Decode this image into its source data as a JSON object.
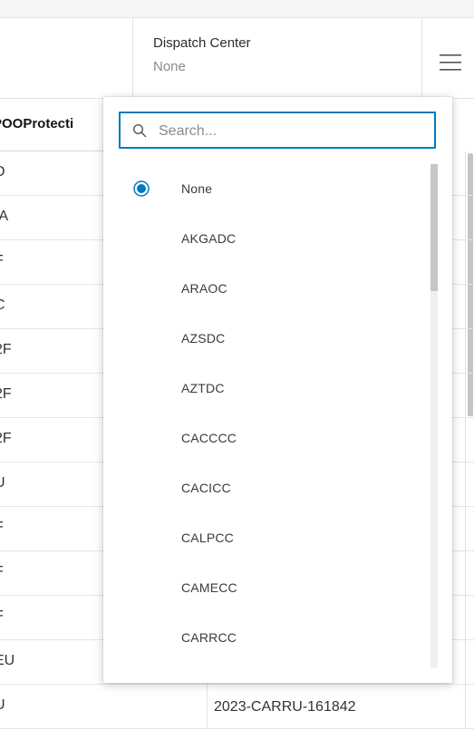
{
  "toolbar": {
    "filter_label": "Dispatch Center",
    "filter_value": "None",
    "menu_icon": "hamburger-menu-icon"
  },
  "table": {
    "column_header": "POOProtecti",
    "rows": [
      {
        "c1": "D",
        "c2": ""
      },
      {
        "c1": "IA",
        "c2": ""
      },
      {
        "c1": "F",
        "c2": ""
      },
      {
        "c1": "C",
        "c2": ""
      },
      {
        "c1": "2F",
        "c2": ""
      },
      {
        "c1": "2F",
        "c2": ""
      },
      {
        "c1": "2F",
        "c2": ""
      },
      {
        "c1": "U",
        "c2": ""
      },
      {
        "c1": "F",
        "c2": ""
      },
      {
        "c1": "F",
        "c2": ""
      },
      {
        "c1": "F",
        "c2": ""
      },
      {
        "c1": "EU",
        "c2": ""
      },
      {
        "c1": "U",
        "c2": "2023-CARRU-161842"
      }
    ]
  },
  "dropdown": {
    "search_placeholder": "Search...",
    "search_icon": "search-icon",
    "selected": "None",
    "options": [
      "None",
      "AKGADC",
      "ARAOC",
      "AZSDC",
      "AZTDC",
      "CACCCC",
      "CACICC",
      "CALPCC",
      "CAMECC",
      "CARRCC"
    ],
    "accent_color": "#0079c1"
  }
}
